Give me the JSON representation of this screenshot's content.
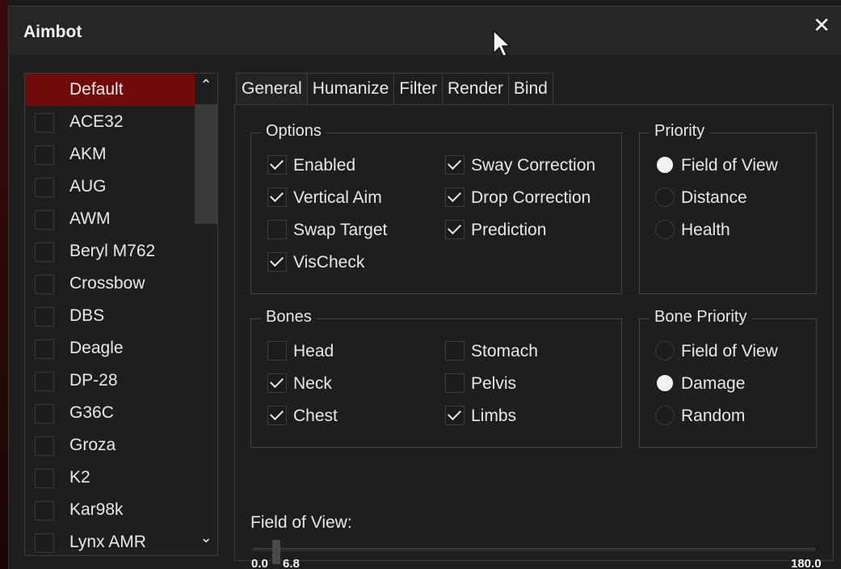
{
  "window": {
    "title": "Aimbot",
    "close_glyph": "✕"
  },
  "weapon_list": {
    "items": [
      {
        "label": "Default",
        "selected": true
      },
      {
        "label": "ACE32"
      },
      {
        "label": "AKM"
      },
      {
        "label": "AUG"
      },
      {
        "label": "AWM"
      },
      {
        "label": "Beryl M762"
      },
      {
        "label": "Crossbow"
      },
      {
        "label": "DBS"
      },
      {
        "label": "Deagle"
      },
      {
        "label": "DP-28"
      },
      {
        "label": "G36C"
      },
      {
        "label": "Groza"
      },
      {
        "label": "K2"
      },
      {
        "label": "Kar98k"
      },
      {
        "label": "Lynx AMR"
      }
    ],
    "scroll_up_glyph": "⌃",
    "scroll_down_glyph": "⌄"
  },
  "tabs": [
    "General",
    "Humanize",
    "Filter",
    "Render",
    "Bind"
  ],
  "active_tab": "General",
  "options": {
    "title": "Options",
    "items": [
      {
        "label": "Enabled",
        "checked": true
      },
      {
        "label": "Vertical Aim",
        "checked": true
      },
      {
        "label": "Swap Target",
        "checked": false
      },
      {
        "label": "VisCheck",
        "checked": true
      },
      {
        "label": "Sway Correction",
        "checked": true
      },
      {
        "label": "Drop Correction",
        "checked": true
      },
      {
        "label": "Prediction",
        "checked": true
      }
    ]
  },
  "priority": {
    "title": "Priority",
    "items": [
      {
        "label": "Field of View",
        "selected": true
      },
      {
        "label": "Distance",
        "selected": false
      },
      {
        "label": "Health",
        "selected": false
      }
    ]
  },
  "bones": {
    "title": "Bones",
    "items": [
      {
        "label": "Head",
        "checked": false
      },
      {
        "label": "Neck",
        "checked": true
      },
      {
        "label": "Chest",
        "checked": true
      },
      {
        "label": "Stomach",
        "checked": false
      },
      {
        "label": "Pelvis",
        "checked": false
      },
      {
        "label": "Limbs",
        "checked": true
      }
    ]
  },
  "bone_priority": {
    "title": "Bone Priority",
    "items": [
      {
        "label": "Field of View",
        "selected": false
      },
      {
        "label": "Damage",
        "selected": true
      },
      {
        "label": "Random",
        "selected": false
      }
    ]
  },
  "fov_slider": {
    "label": "Field of View:",
    "min_label": "0.0",
    "value_label": "6.8",
    "max_label": "180.0",
    "min": 0,
    "max": 180,
    "value": 6.8
  }
}
